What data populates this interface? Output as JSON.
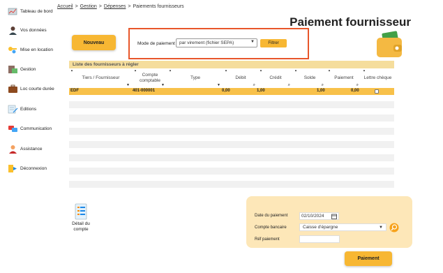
{
  "sidebar": {
    "items": [
      {
        "label": "Tableau de bord",
        "icon": "dashboard-icon"
      },
      {
        "label": "Vos données",
        "icon": "user-icon"
      },
      {
        "label": "Mise en location",
        "icon": "keys-icon"
      },
      {
        "label": "Gestion",
        "icon": "gestion-icon"
      },
      {
        "label": "Loc courte durée",
        "icon": "suitcase-icon"
      },
      {
        "label": "Editions",
        "icon": "editions-icon"
      },
      {
        "label": "Communication",
        "icon": "chat-icon"
      },
      {
        "label": "Assistance",
        "icon": "assistance-icon"
      },
      {
        "label": "Déconnexion",
        "icon": "logout-icon"
      }
    ]
  },
  "breadcrumb": {
    "items": [
      "Accueil",
      "Gestion",
      "Dépenses"
    ],
    "current": "Paiements fournisseurs",
    "separator": ">"
  },
  "page_title": "Paiement fournisseur",
  "toolbar": {
    "new_label": "Nouveau"
  },
  "filter": {
    "label": "Mode de paiement",
    "selected": "par virement (fichier SEPA)",
    "button_label": "Filtrer"
  },
  "table": {
    "caption": "Liste des fournisseurs à régler",
    "columns": [
      "Tiers / Fournisseur",
      "Compte comptable",
      "Type",
      "Débit",
      "Crédit",
      "Solde",
      "Paiement",
      "Lettre chèque"
    ],
    "rows": [
      {
        "tiers": "EDF",
        "compte": "401-000001",
        "type": "",
        "debit": "0,00",
        "credit": "1,00",
        "solde": "1,00",
        "paiement": "0,00",
        "lettre": false
      }
    ]
  },
  "detail_account": {
    "label_line1": "Détail du",
    "label_line2": "compte"
  },
  "payment": {
    "date_label": "Date du paiement",
    "date_value": "02/10/2024",
    "account_label": "Compte bancaire",
    "account_value": "Caisse d'épargne",
    "ref_label": "Réf paiement",
    "ref_value": "",
    "submit_label": "Paiement"
  },
  "colors": {
    "accent": "#f7b733",
    "highlight_row": "#f8c14a",
    "caption_bg": "#f5dd9c",
    "panel_bg": "#fde7b8",
    "filter_border": "#e8562a"
  }
}
